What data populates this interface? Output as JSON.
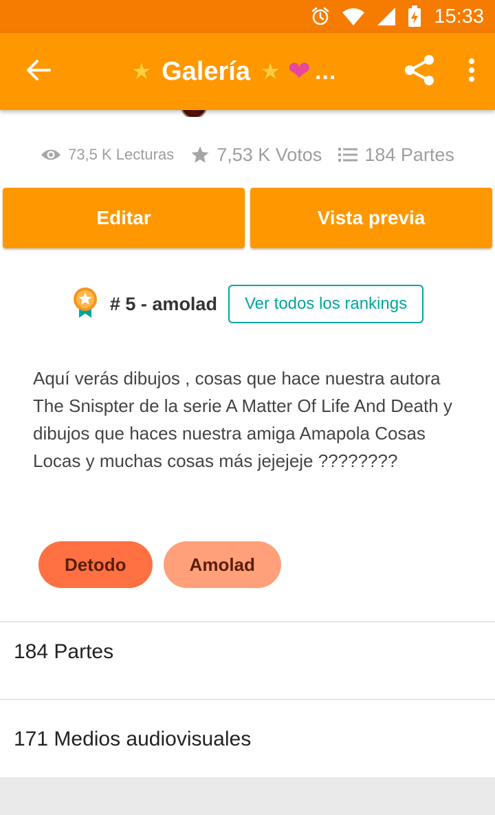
{
  "status_bar": {
    "time": "15:33",
    "icons": [
      "alarm-icon",
      "wifi-icon",
      "signal-icon",
      "battery-charging-icon"
    ]
  },
  "app_bar": {
    "title": "Galería",
    "title_decorations": [
      "star",
      "star",
      "heart"
    ],
    "ellipsis": "...",
    "actions": [
      "back-arrow-icon",
      "share-icon",
      "more-vert-icon"
    ]
  },
  "stats": {
    "reads": "73,5 K Lecturas",
    "votes": "7,53 K Votos",
    "parts": "184 Partes"
  },
  "actions": {
    "edit_label": "Editar",
    "preview_label": "Vista previa"
  },
  "ranking": {
    "text": "# 5 - amolad",
    "see_all_label": "Ver todos los rankings"
  },
  "description": "Aquí verás dibujos , cosas que hace nuestra autora The Snispter de la serie A Matter Of Life And Death y dibujos que haces nuestra amiga Amapola Cosas Locas y muchas cosas más jejejeje ????????",
  "tags": [
    {
      "label": "Detodo"
    },
    {
      "label": "Amolad"
    }
  ],
  "sections": {
    "parts": "184 Partes",
    "media": "171 Medios audiovisuales"
  },
  "colors": {
    "status_bar": "#f57c00",
    "app_bar": "#ff9800",
    "button": "#ff9800",
    "ranking_accent": "#00a69c",
    "tag1": "#ff7043",
    "tag2": "#ffa07a",
    "heart": "#e8489b",
    "star": "#ffcd38"
  }
}
